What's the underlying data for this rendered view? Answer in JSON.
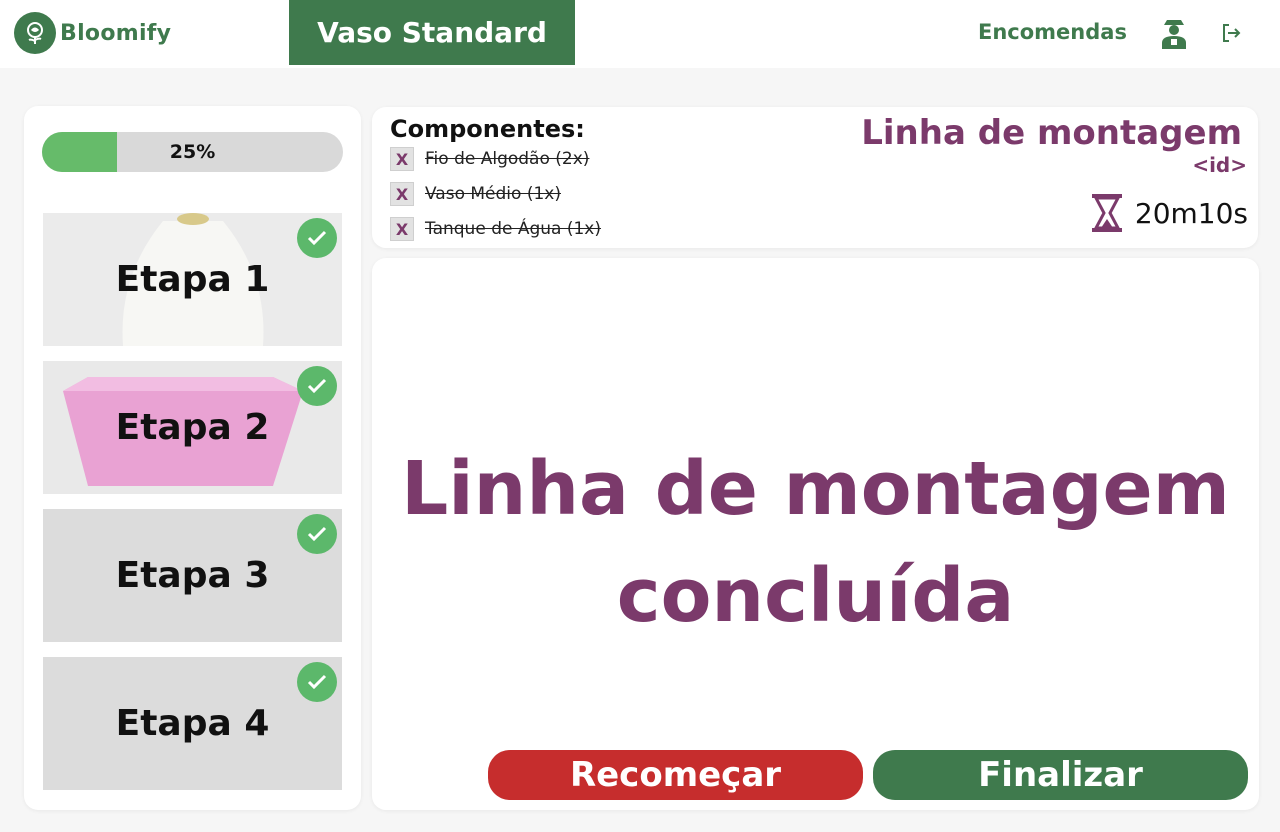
{
  "header": {
    "brand_name": "Bloomify",
    "product_title": "Vaso Standard",
    "orders_label": "Encomendas"
  },
  "progress": {
    "percent": 25,
    "label": "25%"
  },
  "steps": [
    {
      "label": "Etapa 1",
      "completed": true
    },
    {
      "label": "Etapa 2",
      "completed": true
    },
    {
      "label": "Etapa 3",
      "completed": true
    },
    {
      "label": "Etapa 4",
      "completed": true
    }
  ],
  "components": {
    "title": "Componentes:",
    "items": [
      {
        "mark": "X",
        "text": "Fio de Algodão (2x)"
      },
      {
        "mark": "X",
        "text": "Vaso Médio (1x)"
      },
      {
        "mark": "X",
        "text": "Tanque de Água (1x)"
      }
    ]
  },
  "line": {
    "title": "Linha de montagem",
    "id": "<id>",
    "timer": "20m10s"
  },
  "main": {
    "message_line1": "Linha de montagem",
    "message_line2": "concluída",
    "restart_label": "Recomeçar",
    "finish_label": "Finalizar"
  },
  "colors": {
    "brand_green": "#3f7a4d",
    "accent_purple": "#7b3a6b",
    "progress_green": "#66bb6a",
    "danger_red": "#c62d2d"
  },
  "icons": [
    "rose-icon",
    "user-icon",
    "logout-icon",
    "check-icon",
    "hourglass-icon"
  ]
}
